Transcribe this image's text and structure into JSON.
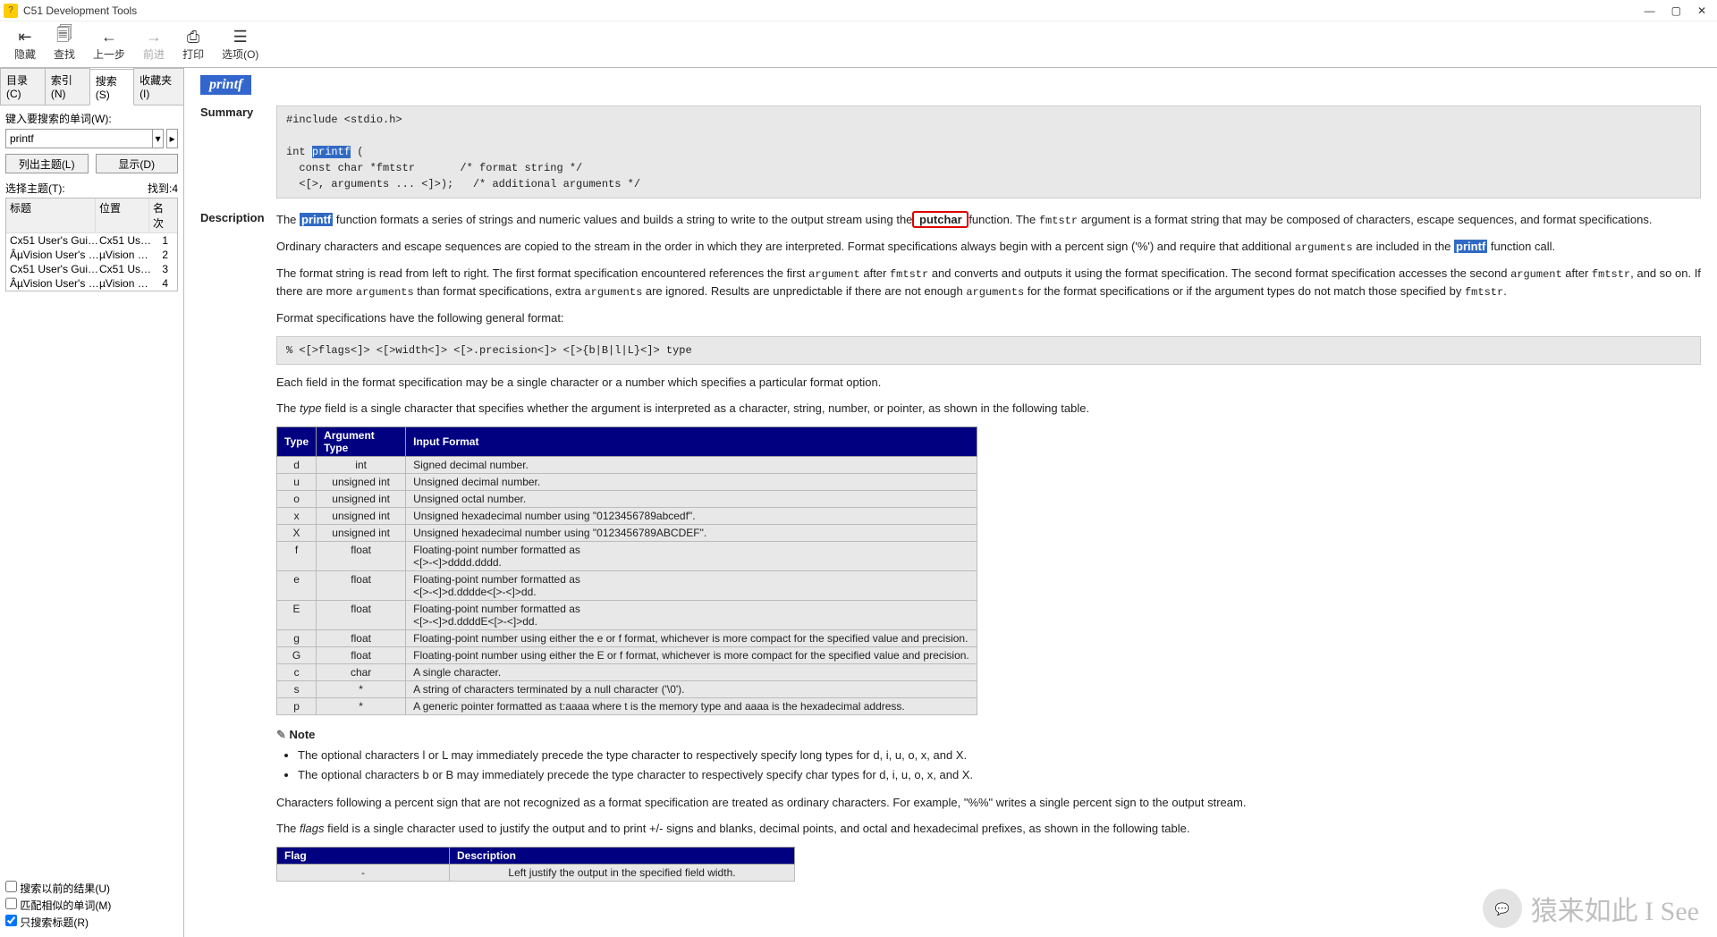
{
  "titlebar": {
    "title": "C51 Development Tools"
  },
  "toolbar": {
    "hide": "隐藏",
    "find": "查找",
    "back": "上一步",
    "forward": "前进",
    "print": "打印",
    "options": "选项(O)"
  },
  "tabs": {
    "contents": "目录(C)",
    "index": "索引(N)",
    "search": "搜索(S)",
    "favorites": "收藏夹(I)"
  },
  "search": {
    "label": "键入要搜索的单词(W):",
    "value": "printf",
    "list_btn": "列出主题(L)",
    "display_btn": "显示(D)",
    "select_label": "选择主题(T):",
    "found": "找到:4",
    "cols": {
      "title": "标题",
      "location": "位置",
      "rank": "名次"
    },
    "results": [
      {
        "t": "Cx51 User's Guide:...",
        "l": "Cx51 User's...",
        "r": "1"
      },
      {
        "t": "ÂµVision User's G...",
        "l": "µVision Us...",
        "r": "2"
      },
      {
        "t": "Cx51 User's Guide:...",
        "l": "Cx51 User's...",
        "r": "3"
      },
      {
        "t": "ÂµVision User's G.",
        "l": "µVision Us...",
        "r": "4"
      }
    ],
    "opts": {
      "prev": "搜索以前的结果(U)",
      "similar": "匹配相似的单词(M)",
      "titles_only": "只搜索标题(R)"
    }
  },
  "page": {
    "title": "printf",
    "summary_label": "Summary",
    "summary_code": "#include <stdio.h>\n\nint printf (\n  const char *fmtstr       /* format string */\n  <[>, arguments ... <]>);   /* additional arguments */",
    "summary_hl": "printf",
    "desc_label": "Description",
    "desc_p1_a": "The ",
    "desc_p1_hl": "printf",
    "desc_p1_b": " function formats a series of strings and numeric values and builds a string to write to the output stream using the",
    "desc_p1_red": " putchar ",
    "desc_p1_c": "function. The ",
    "desc_p1_m1": "fmtstr",
    "desc_p1_d": " argument is a format string that may be composed of characters, escape sequences, and format specifications.",
    "desc_p2_a": "Ordinary characters and escape sequences are copied to the stream in the order in which they are interpreted. Format specifications always begin with a percent sign ('%') and require that additional ",
    "desc_p2_m1": "arguments",
    "desc_p2_b": " are included in the ",
    "desc_p2_hl": "printf",
    "desc_p2_c": " function call.",
    "desc_p3_a": "The format string is read from left to right. The first format specification encountered references the first ",
    "desc_p3_m1": "argument",
    "desc_p3_b": " after ",
    "desc_p3_m2": "fmtstr",
    "desc_p3_c": " and converts and outputs it using the format specification. The second format specification accesses the second ",
    "desc_p3_m3": "argument",
    "desc_p3_d": " after ",
    "desc_p3_m4": "fmtstr",
    "desc_p3_e": ", and so on. If there are more ",
    "desc_p3_m5": "arguments",
    "desc_p3_f": " than format specifications, extra ",
    "desc_p3_m6": "arguments",
    "desc_p3_g": " are ignored. Results are unpredictable if there are not enough ",
    "desc_p3_m7": "arguments",
    "desc_p3_h": " for the format specifications or if the argument types do not match those specified by ",
    "desc_p3_m8": "fmtstr",
    "desc_p3_i": ".",
    "desc_p4": "Format specifications have the following general format:",
    "fmt_code": "% <[>flags<]> <[>width<]> <[>.precision<]> <[>{b|B|l|L}<]> type",
    "desc_p5": "Each field in the format specification may be a single character or a number which specifies a particular format option.",
    "desc_p6_a": "The ",
    "desc_p6_i": "type",
    "desc_p6_b": " field is a single character that specifies whether the argument is interpreted as a character, string, number, or pointer, as shown in the following table.",
    "note_label": "Note",
    "note1": "The optional characters l or L may immediately precede the type character to respectively specify long types for d, i, u, o, x, and X.",
    "note2": "The optional characters b or B may immediately precede the type character to respectively specify char types for d, i, u, o, x, and X.",
    "desc_p7": "Characters following a percent sign that are not recognized as a format specification are treated as ordinary characters. For example, \"%%\" writes a single percent sign to the output stream.",
    "desc_p8_a": "The ",
    "desc_p8_i": "flags",
    "desc_p8_b": " field is a single character used to justify the output and to print +/- signs and blanks, decimal points, and octal and hexadecimal prefixes, as shown in the following table."
  },
  "chart_data": {
    "type": "table",
    "title": "printf format type characters",
    "columns": [
      "Type",
      "Argument Type",
      "Input Format"
    ],
    "rows": [
      [
        "d",
        "int",
        "Signed decimal number."
      ],
      [
        "u",
        "unsigned int",
        "Unsigned decimal number."
      ],
      [
        "o",
        "unsigned int",
        "Unsigned octal number."
      ],
      [
        "x",
        "unsigned int",
        "Unsigned hexadecimal number using \"0123456789abcedf\"."
      ],
      [
        "X",
        "unsigned int",
        "Unsigned hexadecimal number using \"0123456789ABCDEF\"."
      ],
      [
        "f",
        "float",
        "Floating-point number formatted as\n<[>-<]>dddd.dddd."
      ],
      [
        "e",
        "float",
        "Floating-point number formatted as\n<[>-<]>d.dddde<[>-<]>dd."
      ],
      [
        "E",
        "float",
        "Floating-point number formatted as\n<[>-<]>d.ddddE<[>-<]>dd."
      ],
      [
        "g",
        "float",
        "Floating-point number using either the e or f format, whichever is more compact for the specified value and precision."
      ],
      [
        "G",
        "float",
        "Floating-point number using either the E or f format, whichever is more compact for the specified value and precision."
      ],
      [
        "c",
        "char",
        "A single character."
      ],
      [
        "s",
        "*",
        "A string of characters terminated by a null character ('\\0')."
      ],
      [
        "p",
        "*",
        "A generic pointer formatted as t:aaaa where t is the memory type and aaaa is the hexadecimal address."
      ]
    ]
  },
  "flag_table": {
    "columns": [
      "Flag",
      "Description"
    ],
    "rows": [
      [
        "-",
        "Left justify the output in the specified field width."
      ]
    ]
  },
  "watermark": "猿来如此 I See"
}
